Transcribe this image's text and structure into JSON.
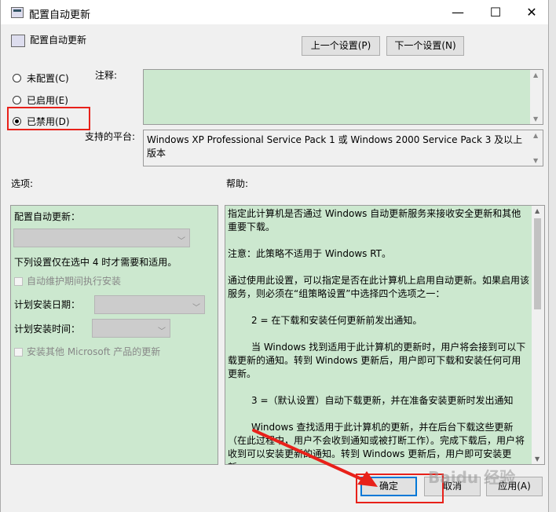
{
  "window": {
    "title": "配置自动更新",
    "header_title": "配置自动更新"
  },
  "nav": {
    "prev_label": "上一个设置(P)",
    "next_label": "下一个设置(N)"
  },
  "state": {
    "options": [
      {
        "label": "未配置(C)",
        "selected": false
      },
      {
        "label": "已启用(E)",
        "selected": false
      },
      {
        "label": "已禁用(D)",
        "selected": true
      }
    ]
  },
  "comment": {
    "label": "注释:",
    "value": ""
  },
  "platform": {
    "label": "支持的平台:",
    "value": "Windows XP Professional Service Pack 1 或 Windows 2000 Service Pack 3 及以上版本"
  },
  "sections": {
    "options_label": "选项:",
    "help_label": "帮助:"
  },
  "options_panel": {
    "configure_label": "配置自动更新：",
    "note": "下列设置仅在选中 4 时才需要和适用。",
    "maintenance_label": "自动维护期间执行安装",
    "schedule_day_label": "计划安装日期：",
    "schedule_time_label": "计划安装时间：",
    "other_products_label": "安装其他 Microsoft 产品的更新"
  },
  "help": {
    "paragraphs": [
      "指定此计算机是否通过 Windows 自动更新服务来接收安全更新和其他重要下载。",
      "注意：此策略不适用于 Windows RT。",
      "通过使用此设置，可以指定是否在此计算机上启用自动更新。如果启用该服务，则必须在“组策略设置”中选择四个选项之一：",
      "2 = 在下载和安装任何更新前发出通知。",
      "当 Windows 找到适用于此计算机的更新时，用户将会接到可以下载更新的通知。转到 Windows 更新后，用户即可下载和安装任何可用更新。",
      "3 =（默认设置）自动下载更新，并在准备安装更新时发出通知",
      "Windows 查找适用于此计算机的更新，并在后台下载这些更新（在此过程中，用户不会收到通知或被打断工作）。完成下载后，用户将收到可以安装更新的通知。转到 Windows 更新后，用户即可安装更新。"
    ]
  },
  "footer": {
    "ok_label": "确定",
    "cancel_label": "取消",
    "apply_label": "应用(A)"
  },
  "watermark": "Baidu 经验",
  "colors": {
    "panel_green": "#cce8cf",
    "highlight_red": "#e8211a"
  }
}
